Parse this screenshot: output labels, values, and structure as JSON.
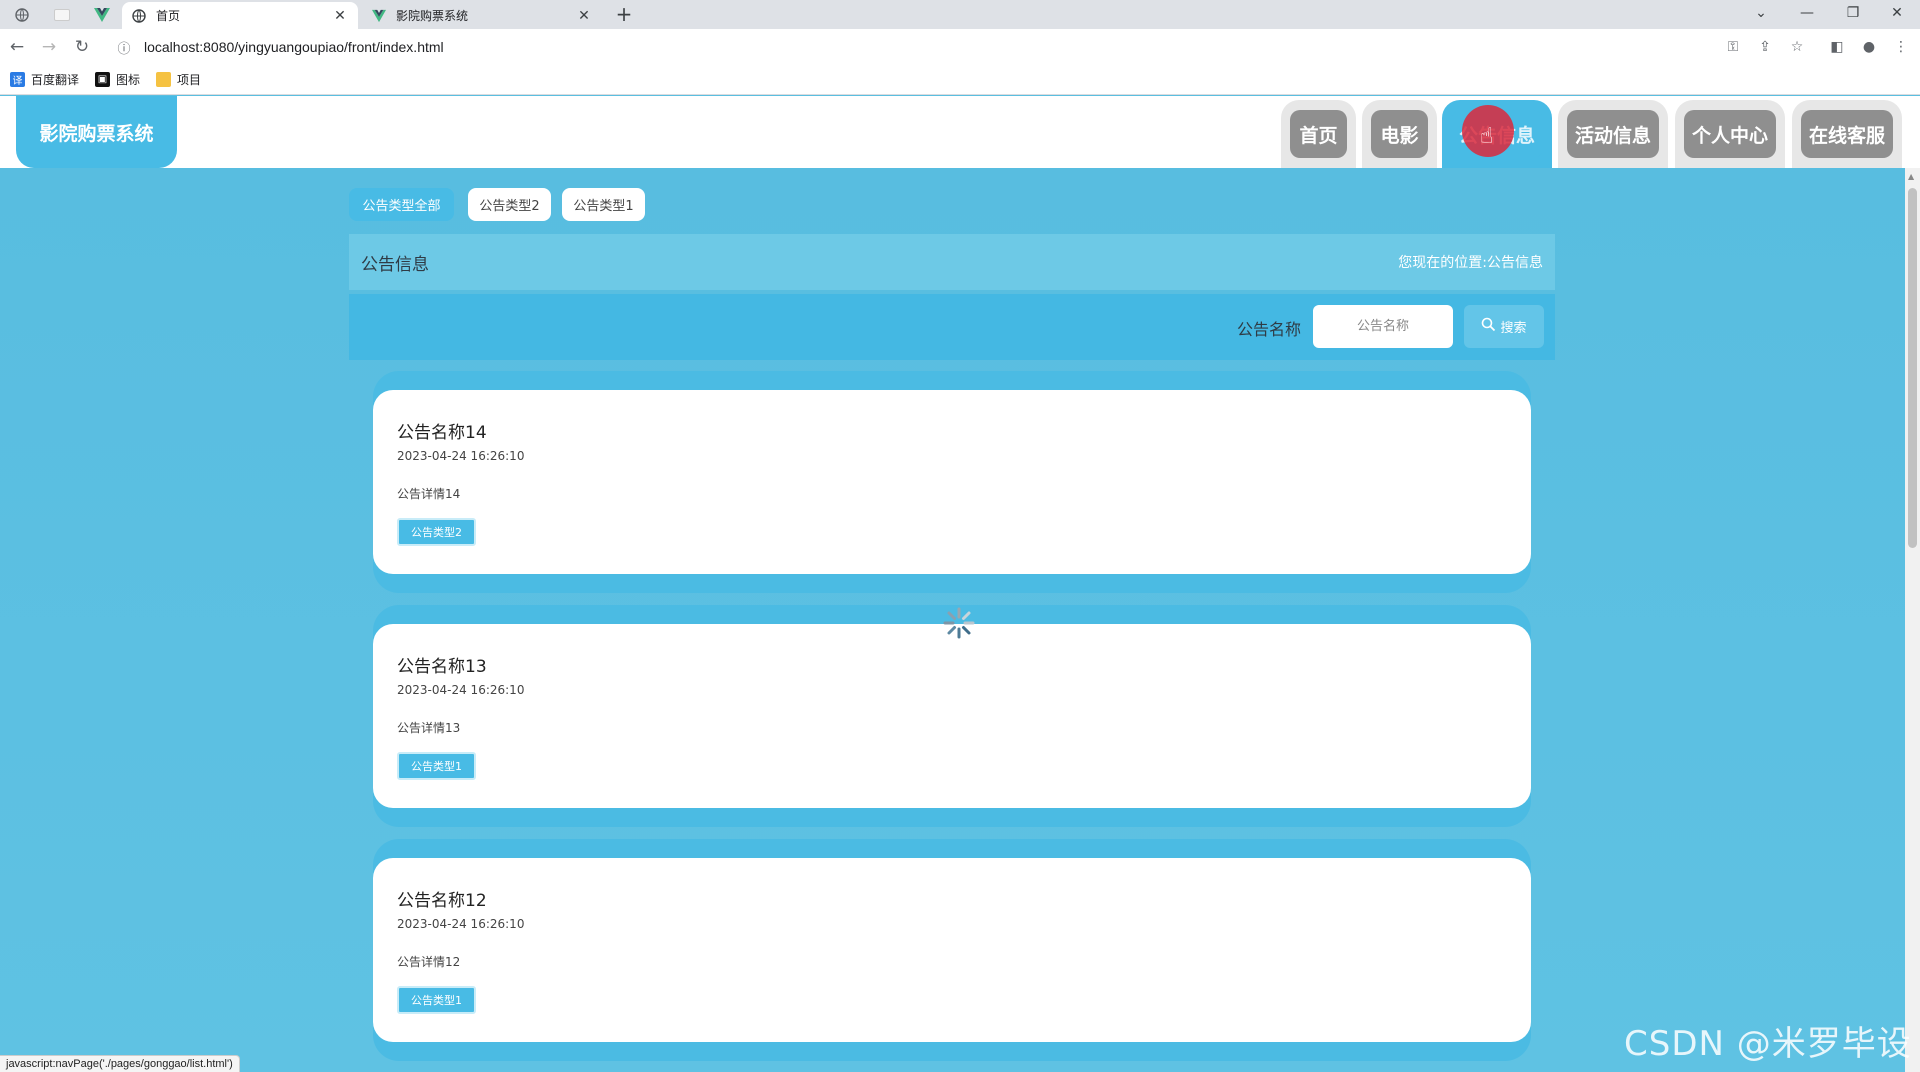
{
  "browser": {
    "tabs": [
      {
        "title": "首页",
        "active": true
      },
      {
        "title": "影院购票系统",
        "active": false
      }
    ],
    "url": "localhost:8080/yingyuangoupiao/front/index.html",
    "bookmarks": [
      "百度翻译",
      "图标",
      "项目"
    ],
    "status_url": "javascript:navPage('./pages/gonggao/list.html')"
  },
  "site": {
    "logo": "影院购票系统",
    "nav": [
      "首页",
      "电影",
      "公告信息",
      "活动信息",
      "个人中心",
      "在线客服"
    ],
    "active_nav": "公告信息"
  },
  "filters": [
    "公告类型全部",
    "公告类型2",
    "公告类型1"
  ],
  "page": {
    "title": "公告信息",
    "location_label": "您现在的位置:",
    "location_value": "公告信息"
  },
  "search": {
    "label": "公告名称",
    "placeholder": "公告名称",
    "button": "搜索"
  },
  "notices": [
    {
      "name": "公告名称14",
      "time": "2023-04-24 16:26:10",
      "detail": "公告详情14",
      "type": "公告类型2"
    },
    {
      "name": "公告名称13",
      "time": "2023-04-24 16:26:10",
      "detail": "公告详情13",
      "type": "公告类型1"
    },
    {
      "name": "公告名称12",
      "time": "2023-04-24 16:26:10",
      "detail": "公告详情12",
      "type": "公告类型1"
    }
  ],
  "watermark": "CSDN @米罗毕设",
  "colors": {
    "accent": "#48bbe5",
    "nav_inactive": "#8f8f8f",
    "background": "#5bbfe0"
  }
}
